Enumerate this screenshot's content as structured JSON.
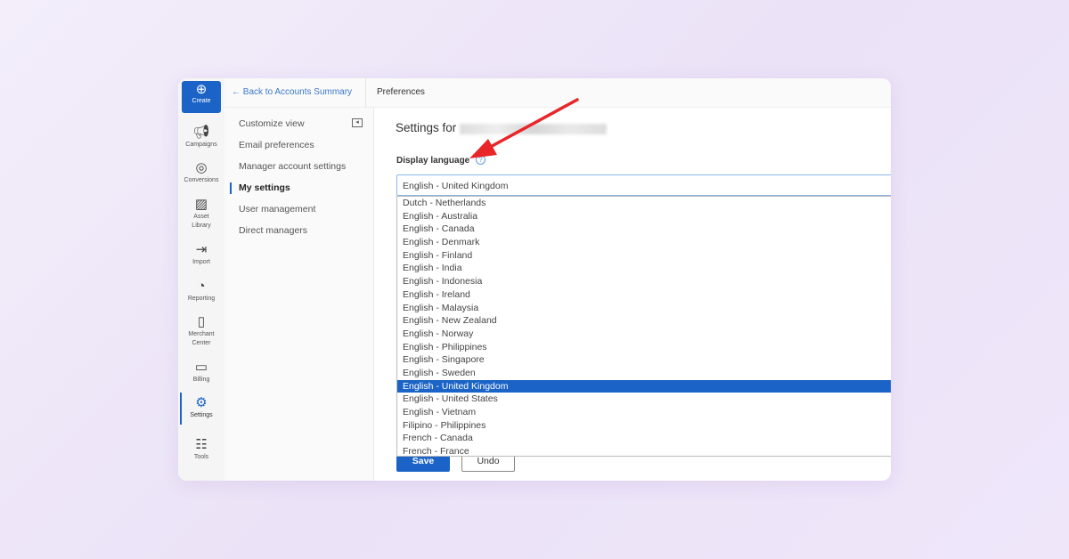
{
  "rail": {
    "create": "Create",
    "items": [
      {
        "label": "Campaigns",
        "icon": "megaphone-icon"
      },
      {
        "label": "Conversions",
        "icon": "target-icon"
      },
      {
        "label": "Asset\nLibrary",
        "icon": "image-edit-icon"
      },
      {
        "label": "Import",
        "icon": "import-arrow-icon"
      },
      {
        "label": "Reporting",
        "icon": "chart-icon"
      },
      {
        "label": "Merchant\nCenter",
        "icon": "shopping-bag-icon"
      },
      {
        "label": "Billing",
        "icon": "wallet-icon"
      },
      {
        "label": "Settings",
        "icon": "gear-icon"
      },
      {
        "label": "Tools",
        "icon": "list-icon"
      }
    ]
  },
  "topbar": {
    "back": "Back to Accounts Summary",
    "crumb": "Preferences"
  },
  "nav": {
    "items": [
      "Customize view",
      "Email preferences",
      "Manager account settings",
      "My settings",
      "User management",
      "Direct managers"
    ],
    "selected": "My settings"
  },
  "main": {
    "title": "Settings for",
    "language_label": "Display language",
    "language_value": "English - United Kingdom",
    "options": [
      "Dutch - Netherlands",
      "English - Australia",
      "English - Canada",
      "English - Denmark",
      "English - Finland",
      "English - India",
      "English - Indonesia",
      "English - Ireland",
      "English - Malaysia",
      "English - New Zealand",
      "English - Norway",
      "English - Philippines",
      "English - Singapore",
      "English - Sweden",
      "English - United Kingdom",
      "English - United States",
      "English - Vietnam",
      "Filipino - Philippines",
      "French - Canada",
      "French - France"
    ],
    "save": "Save",
    "undo": "Undo"
  },
  "colors": {
    "accent": "#1b63c6",
    "annotation_arrow": "#e8262a"
  }
}
